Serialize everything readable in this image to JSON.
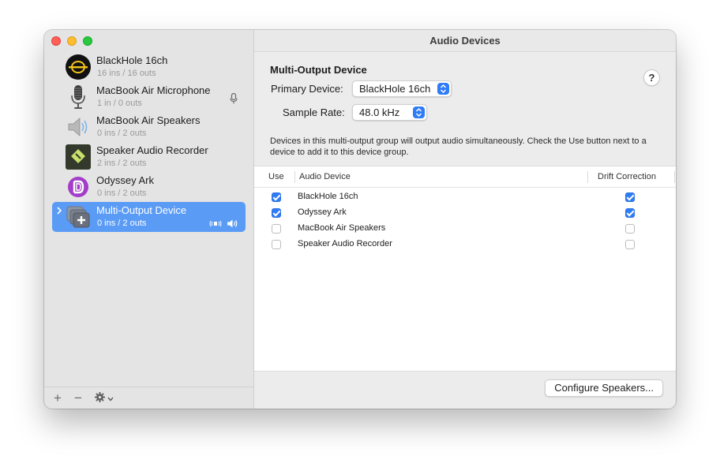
{
  "window": {
    "title": "Audio Devices"
  },
  "sidebar": {
    "devices": [
      {
        "name": "BlackHole 16ch",
        "io": "16 ins / 16 outs",
        "icon": "blackhole-icon"
      },
      {
        "name": "MacBook Air Microphone",
        "io": "1 in / 0 outs",
        "icon": "microphone-icon"
      },
      {
        "name": "MacBook Air Speakers",
        "io": "0 ins / 2 outs",
        "icon": "speaker-icon"
      },
      {
        "name": "Speaker Audio Recorder",
        "io": "2 ins / 2 outs",
        "icon": "recorder-app-icon"
      },
      {
        "name": "Odyssey Ark",
        "io": "0 ins / 2 outs",
        "icon": "display-port-icon"
      },
      {
        "name": "Multi-Output Device",
        "io": "0 ins / 2 outs",
        "icon": "multi-output-icon",
        "selected": true
      }
    ],
    "footer": {
      "add": "+",
      "remove": "−"
    }
  },
  "main": {
    "section_title": "Multi-Output Device",
    "primary_label": "Primary Device:",
    "primary_value": "BlackHole 16ch",
    "rate_label": "Sample Rate:",
    "rate_value": "48.0 kHz",
    "help": "?",
    "description": "Devices in this multi-output group will output audio simultaneously. Check the Use button next to a device to add it to this device group.",
    "columns": {
      "use": "Use",
      "device": "Audio Device",
      "drift": "Drift Correction"
    },
    "rows": [
      {
        "name": "BlackHole 16ch",
        "use": true,
        "drift": true
      },
      {
        "name": "Odyssey Ark",
        "use": true,
        "drift": true
      },
      {
        "name": "MacBook Air Speakers",
        "use": false,
        "drift": false
      },
      {
        "name": "Speaker Audio Recorder",
        "use": false,
        "drift": false
      }
    ],
    "configure_button": "Configure Speakers..."
  },
  "colors": {
    "accent": "#2f7cf6",
    "selection": "#5a9bf6"
  }
}
